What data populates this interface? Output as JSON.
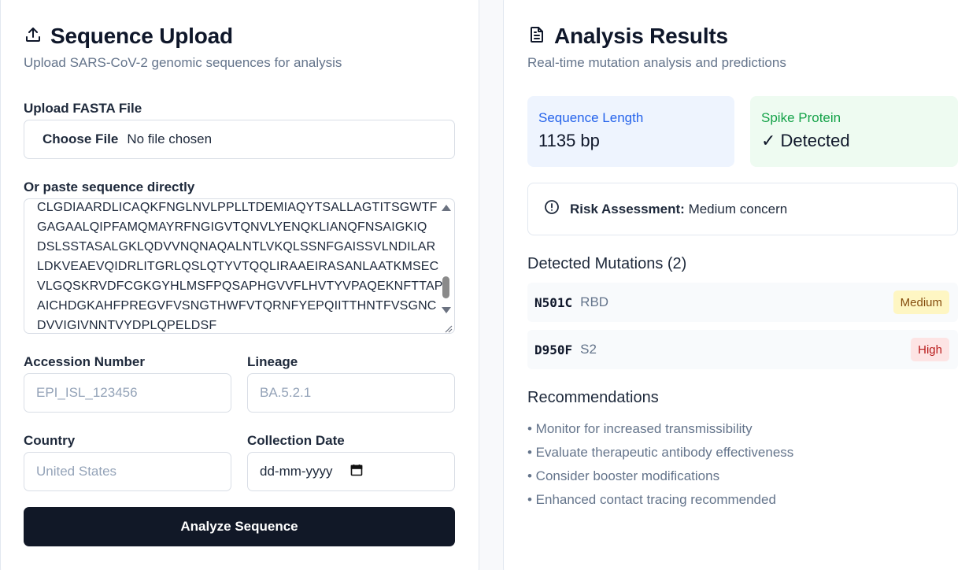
{
  "upload": {
    "title": "Sequence Upload",
    "subtitle": "Upload SARS-CoV-2 genomic sequences for analysis",
    "fasta_label": "Upload FASTA File",
    "file_button": "Choose File",
    "file_status": "No file chosen",
    "paste_label": "Or paste sequence directly",
    "sequence_lines": [
      "CLGDIAARDLICAQKFNGLNVLPPLLTDEMIAQYTSALLAGTITSGWTF",
      "GAGAALQIPFAMQMAYRFNGIGVTQNVLYENQKLIANQFNSAIGKIQ",
      "DSLSSTASALGKLQDVVNQNAQALNTLVKQLSSNFGAISSVLNDILAR",
      "LDKVEAEVQIDRLITGRLQSLQTYVTQQLIRAAEIRASANLAATKMSEC",
      "VLGQSKRVDFCGKGYHLMSFPQSAPHGVVFLHVTYVPAQEKNFTTAP",
      "AICHDGKAHFPREGVFVSNGTHWFVTQRNFYEPQIITTHNTFVSGNC",
      "DVVIGIVNNTVYDPLQPELDSF"
    ],
    "accession_label": "Accession Number",
    "accession_placeholder": "EPI_ISL_123456",
    "lineage_label": "Lineage",
    "lineage_placeholder": "BA.5.2.1",
    "country_label": "Country",
    "country_placeholder": "United States",
    "date_label": "Collection Date",
    "date_placeholder": "dd-mm-yyyy",
    "submit_label": "Analyze Sequence"
  },
  "results": {
    "title": "Analysis Results",
    "subtitle": "Real-time mutation analysis and predictions",
    "seq_length_label": "Sequence Length",
    "seq_length_value": "1135 bp",
    "spike_label": "Spike Protein",
    "spike_value": "✓ Detected",
    "risk_label": "Risk Assessment:",
    "risk_value": "Medium concern",
    "mutations_title": "Detected Mutations (2)",
    "mutations": [
      {
        "code": "N501C",
        "region": "RBD",
        "severity": "Medium"
      },
      {
        "code": "D950F",
        "region": "S2",
        "severity": "High"
      }
    ],
    "recommendations_title": "Recommendations",
    "recommendations": [
      "• Monitor for increased transmissibility",
      "• Evaluate therapeutic antibody effectiveness",
      "• Consider booster modifications",
      "• Enhanced contact tracing recommended"
    ]
  },
  "colors": {
    "primary_button": "#111827",
    "stat_blue": "#eef4fe",
    "stat_green": "#eefbf1",
    "badge_medium": "#fef6c3",
    "badge_high": "#fde4e4"
  }
}
